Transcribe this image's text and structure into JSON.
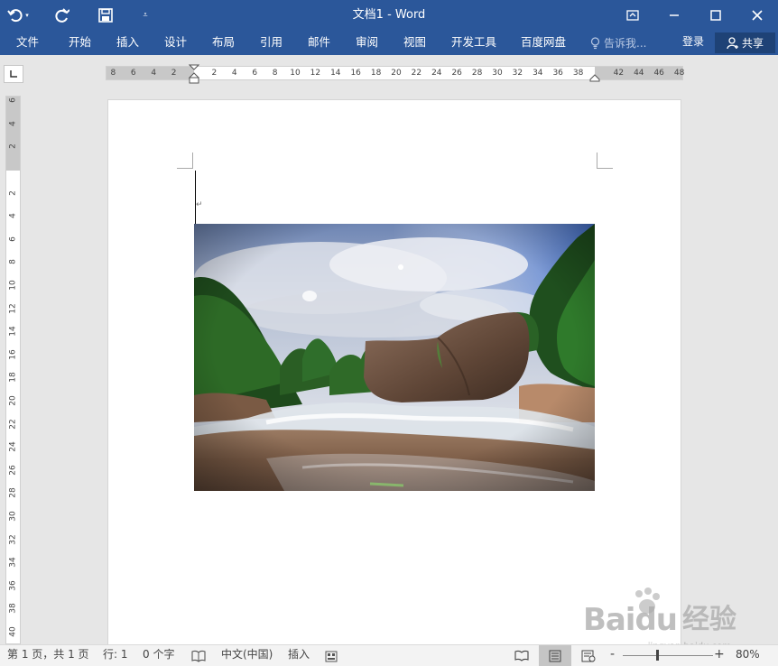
{
  "titlebar": {
    "title": "文档1 - Word",
    "undo_icon": "undo-icon",
    "redo_icon": "redo-icon",
    "save_icon": "save-icon",
    "customize_icon": "customize-qat-icon",
    "ribbon_display_icon": "ribbon-display-icon",
    "minimize_icon": "minimize-icon",
    "maximize_icon": "maximize-icon",
    "close_icon": "close-icon",
    "background_color": "#2b579a"
  },
  "ribbon": {
    "tabs": [
      {
        "label": "文件"
      },
      {
        "label": "开始"
      },
      {
        "label": "插入"
      },
      {
        "label": "设计"
      },
      {
        "label": "布局"
      },
      {
        "label": "引用"
      },
      {
        "label": "邮件"
      },
      {
        "label": "审阅"
      },
      {
        "label": "视图"
      },
      {
        "label": "开发工具"
      },
      {
        "label": "百度网盘"
      }
    ],
    "tell_me": "告诉我...",
    "login": "登录",
    "share": "共享"
  },
  "ruler": {
    "horizontal_ticks": [
      "8",
      "6",
      "4",
      "2",
      "2",
      "4",
      "6",
      "8",
      "10",
      "12",
      "14",
      "16",
      "18",
      "20",
      "22",
      "24",
      "26",
      "28",
      "30",
      "32",
      "34",
      "36",
      "38",
      "42",
      "44",
      "46",
      "48"
    ],
    "vertical_ticks": [
      "6",
      "4",
      "2",
      "2",
      "4",
      "6",
      "8",
      "10",
      "12",
      "14",
      "16",
      "18",
      "20",
      "22",
      "24",
      "26",
      "28",
      "30",
      "32",
      "34",
      "36",
      "38",
      "40"
    ]
  },
  "document": {
    "image_description_icon": "landscape-photo"
  },
  "watermark": {
    "brand": "Baidu",
    "brand_cn": "经验",
    "url": "jingyan.baidu.com"
  },
  "statusbar": {
    "page_info": "第 1 页，共 1 页",
    "line": "行: 1",
    "word_count": "0 个字",
    "language": "中文(中国)",
    "mode": "插入",
    "zoom": "80%",
    "zoom_minus": "-",
    "zoom_plus": "+"
  }
}
